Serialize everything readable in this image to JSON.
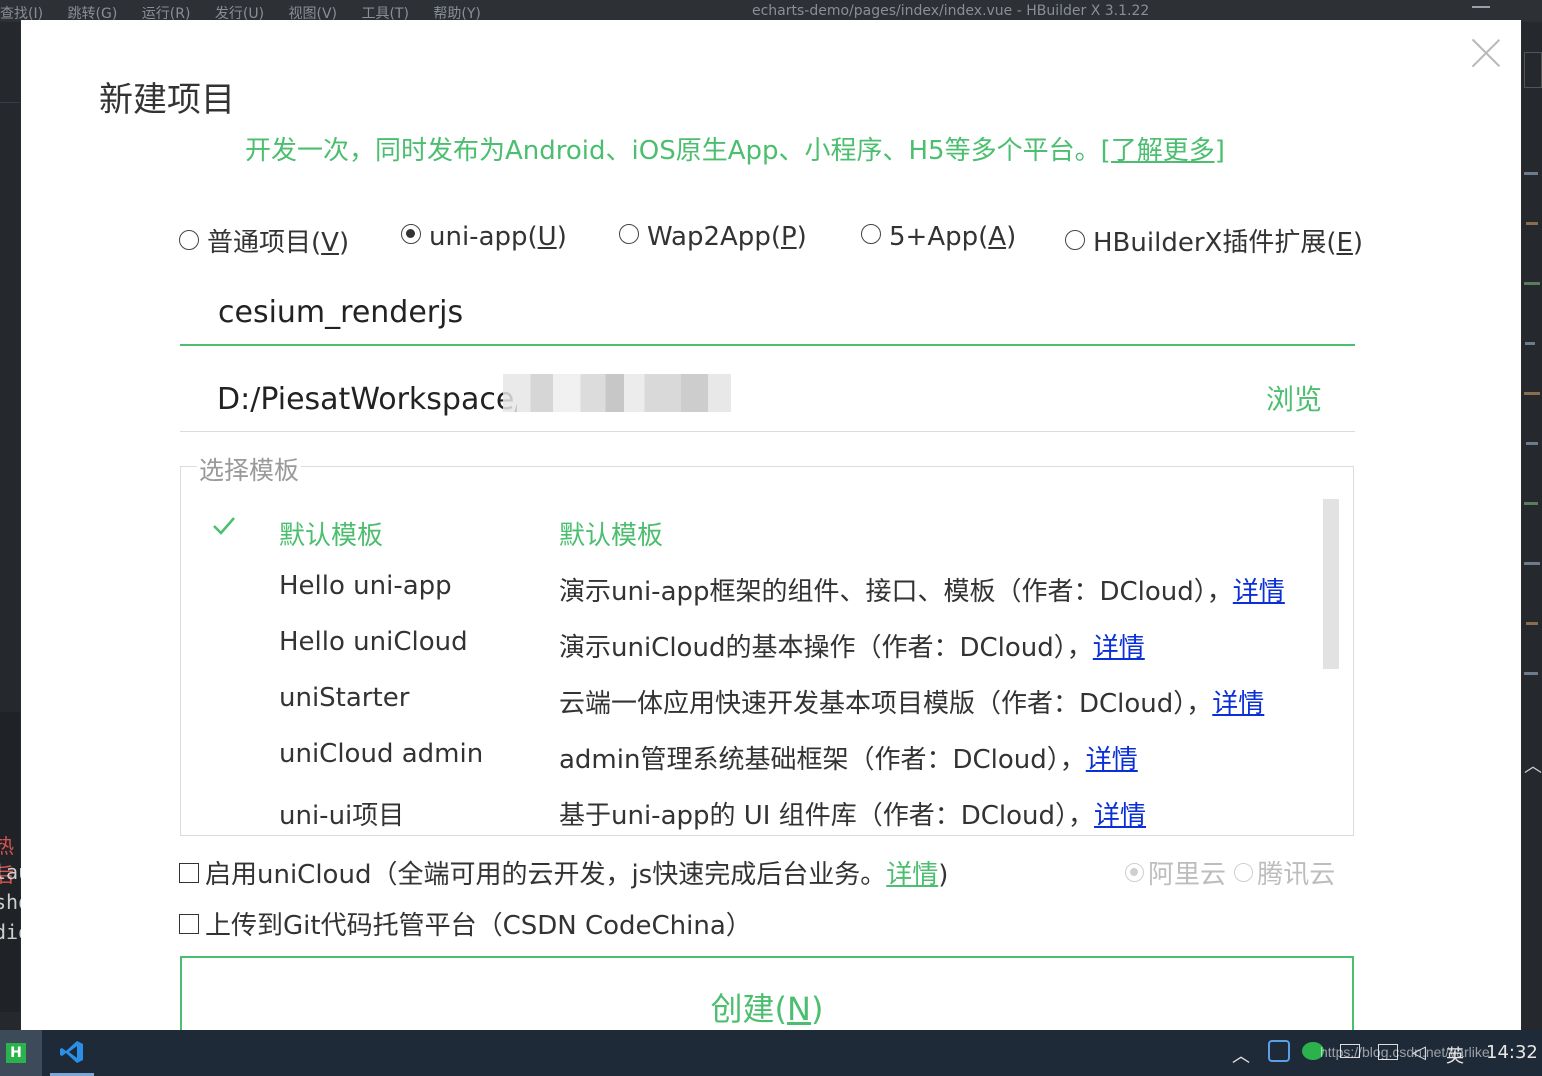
{
  "editor": {
    "menu_items": [
      "查找(I)",
      "跳转(G)",
      "运行(R)",
      "发行(U)",
      "视图(V)",
      "工具(T)",
      "帮助(Y)"
    ],
    "window_title": "echarts-demo/pages/index/index.vue - HBuilder X 3.1.22",
    "left_fragments": [
      "热后",
      "lau",
      "sho",
      "dio"
    ]
  },
  "dialog": {
    "title": "新建项目",
    "subtitle": "开发一次，同时发布为Android、iOS原生App、小程序、H5等多个平台。",
    "learn_more": "[了解更多]",
    "project_types": [
      {
        "label": "普通项目(",
        "key": "V",
        "suffix": ")",
        "selected": false
      },
      {
        "label": "uni-app(",
        "key": "U",
        "suffix": ")",
        "selected": true
      },
      {
        "label": "Wap2App(",
        "key": "P",
        "suffix": ")",
        "selected": false
      },
      {
        "label": "5+App(",
        "key": "A",
        "suffix": ")",
        "selected": false
      },
      {
        "label": "HBuilderX插件扩展(",
        "key": "E",
        "suffix": ")",
        "selected": false
      }
    ],
    "project_name": "cesium_renderjs",
    "project_path": "D:/PiesatWorkspace/",
    "browse_label": "浏览",
    "template_legend": "选择模板",
    "templates": [
      {
        "name": "默认模板",
        "desc": "默认模板",
        "link": "",
        "selected": true
      },
      {
        "name": "Hello uni-app",
        "desc": "演示uni-app框架的组件、接口、模板（作者：DCloud），",
        "link": "详情",
        "selected": false
      },
      {
        "name": "Hello uniCloud",
        "desc": "演示uniCloud的基本操作（作者：DCloud），",
        "link": "详情",
        "selected": false
      },
      {
        "name": "uniStarter",
        "desc": "云端一体应用快速开发基本项目模版（作者：DCloud），",
        "link": "详情",
        "selected": false
      },
      {
        "name": "uniCloud admin",
        "desc": "admin管理系统基础框架（作者：DCloud），",
        "link": "详情",
        "selected": false
      },
      {
        "name": "uni-ui项目",
        "desc": "基于uni-app的 UI 组件库（作者：DCloud），",
        "link": "详情",
        "selected": false
      }
    ],
    "unicloud": {
      "label": "启用uniCloud（全端可用的云开发，js快速完成后台业务。",
      "link": "详情",
      "suffix": ")",
      "checked": false,
      "providers": [
        {
          "label": "阿里云",
          "selected": true
        },
        {
          "label": "腾讯云",
          "selected": false
        }
      ]
    },
    "git_upload": {
      "label": "上传到Git代码托管平台（CSDN CodeChina）",
      "checked": false
    },
    "create_button": {
      "label": "创建(",
      "key": "N",
      "suffix": ")"
    }
  },
  "taskbar": {
    "ime": "英",
    "clock": "14:32",
    "watermark": "https://blog.csdn.net/varlike"
  },
  "colors": {
    "accent": "#4cbe6f",
    "link": "#0b2fd6",
    "taskbar": "#1e2a38"
  }
}
